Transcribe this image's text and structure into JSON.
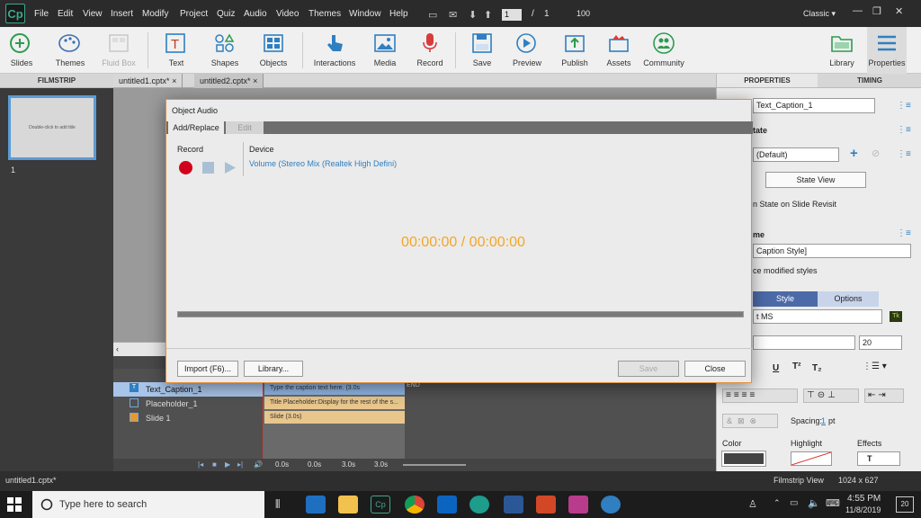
{
  "app": {
    "logo": "Cp",
    "menu": [
      "File",
      "Edit",
      "View",
      "Insert",
      "Modify",
      "Project",
      "Quiz",
      "Audio",
      "Video",
      "Themes",
      "Window",
      "Help"
    ],
    "page_current": "1",
    "page_sep": "/",
    "page_total": "1",
    "zoom": "100",
    "workspace": "Classic ▾"
  },
  "toolbar": {
    "tools": [
      "Slides",
      "Themes",
      "Fluid Box",
      "Text",
      "Shapes",
      "Objects",
      "Interactions",
      "Media",
      "Record",
      "Save",
      "Preview",
      "Publish",
      "Assets",
      "Community"
    ],
    "right": [
      "Library",
      "Properties"
    ]
  },
  "filmstrip": {
    "title": "FILMSTRIP",
    "thumb_text": "Double-click to add title",
    "slide_num": "1"
  },
  "tabs": [
    {
      "label": "untitled1.cptx*",
      "close": "×"
    },
    {
      "label": "untitled2.cptx*",
      "close": "×"
    }
  ],
  "timeline": {
    "rows": [
      "Text_Caption_1",
      "Placeholder_1",
      "Slide 1"
    ],
    "bars": [
      "Type the caption text here. (3.0s",
      "Title Placeholder:Display for the rest of the s...",
      "Slide (3.0s)"
    ],
    "end": "END",
    "times": [
      "0.0s",
      "0.0s",
      "3.0s",
      "3.0s"
    ]
  },
  "props": {
    "tabs": [
      "PROPERTIES",
      "TIMING"
    ],
    "name": "Text_Caption_1",
    "state_label": "tate",
    "state_value": "(Default)",
    "state_view": "State View",
    "revisit": "n State on Slide Revisit",
    "style_label": "me",
    "style_value": "Caption Style]",
    "modified": "ce modified styles",
    "style_tabs": [
      "Style",
      "Options"
    ],
    "font": "t MS",
    "size": "20",
    "spacing_label": "Spacing:",
    "spacing_value": "1",
    "spacing_unit": "pt",
    "color_label": "Color",
    "highlight_label": "Highlight",
    "effects_label": "Effects",
    "effects_value": "T"
  },
  "status": {
    "file": "untitled1.cptx*",
    "view": "Filmstrip View",
    "size": "1024 x 627"
  },
  "taskbar": {
    "search_placeholder": "Type here to search",
    "time": "4:55 PM",
    "date": "11/8/2019",
    "notif": "20"
  },
  "dialog": {
    "title": "Object Audio",
    "tabs": [
      "Add/Replace",
      "Edit"
    ],
    "record_label": "Record",
    "device_label": "Device",
    "device_value": "Volume (Stereo Mix (Realtek High Defini)",
    "timer": "00:00:00 / 00:00:00",
    "buttons": {
      "import": "Import (F6)...",
      "library": "Library...",
      "save": "Save",
      "close": "Close"
    }
  },
  "colors": {
    "accent": "#f5a623",
    "record": "#d0021b",
    "link": "#2f7fc1",
    "selected_row": "#a8c4e8"
  }
}
